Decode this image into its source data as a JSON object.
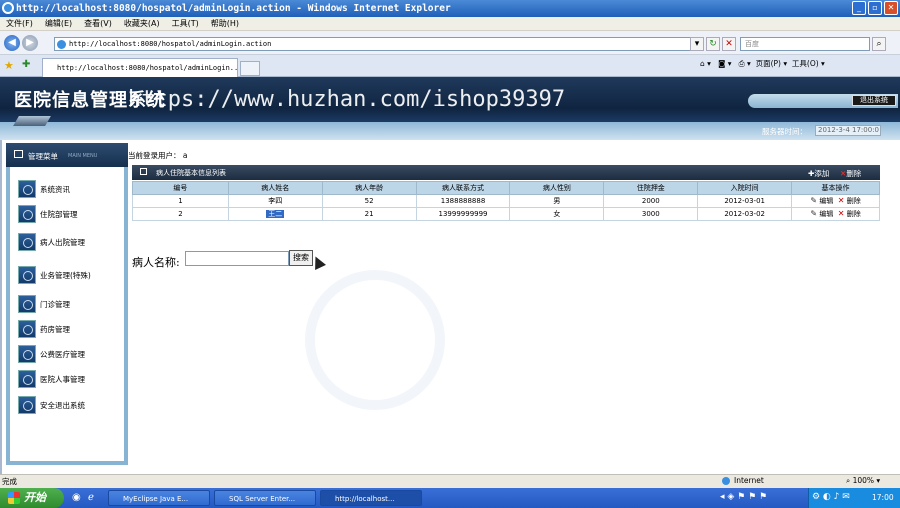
{
  "window": {
    "title": "http://localhost:8080/hospatol/adminLogin.action - Windows Internet Explorer"
  },
  "menu": [
    "文件(F)",
    "编辑(E)",
    "查看(V)",
    "收藏夹(A)",
    "工具(T)",
    "帮助(H)"
  ],
  "address": {
    "url": "http://localhost:8080/hospatol/adminLogin.action",
    "search_placeholder": "百度"
  },
  "tab": {
    "label": "http://localhost:8080/hospatol/adminLogin..."
  },
  "toolbar": {
    "page_label": "页面(P)",
    "tools_label": "工具(O)"
  },
  "app": {
    "title": "医院信息管理系统",
    "watermark": "https://www.huzhan.com/ishop39397",
    "logout_label": "退出系统",
    "server_time_label": "服务器时间：",
    "server_time_value": "2012-3-4 17:00:0"
  },
  "sidebar": {
    "title": "管理菜单",
    "subtitle": "MAIN MENU",
    "items": [
      "系统资讯",
      "住院部管理",
      "病人出院管理",
      "业务管理(特殊)",
      "门诊管理",
      "药房管理",
      "公费医疗管理",
      "医院人事管理",
      "安全退出系统"
    ]
  },
  "current_user": {
    "label": "当前登录用户：",
    "value": "a"
  },
  "panel": {
    "title": "病人住院基本信息列表",
    "add_label": "添加",
    "delete_label": "删除"
  },
  "table": {
    "headers": [
      "编号",
      "病人姓名",
      "病人年龄",
      "病人联系方式",
      "病人性别",
      "住院押金",
      "入院时间",
      "基本操作"
    ],
    "rows": [
      {
        "id": "1",
        "name": "李四",
        "age": "52",
        "phone": "1388888888",
        "gender": "男",
        "deposit": "2000",
        "date": "2012-03-01",
        "edit": "编辑",
        "delete": "删除"
      },
      {
        "id": "2",
        "name": "王二",
        "age": "21",
        "phone": "13999999999",
        "gender": "女",
        "deposit": "3000",
        "date": "2012-03-02",
        "edit": "编辑",
        "delete": "删除"
      }
    ]
  },
  "search": {
    "label": "病人名称:",
    "button": "搜索",
    "value": ""
  },
  "status": {
    "text": "完成",
    "zone": "Internet",
    "zoom": "100%"
  },
  "taskbar": {
    "start": "开始",
    "items": [
      "MyEclipse Java E...",
      "SQL Server Enter...",
      "http://localhost..."
    ],
    "clock": "17:00"
  }
}
